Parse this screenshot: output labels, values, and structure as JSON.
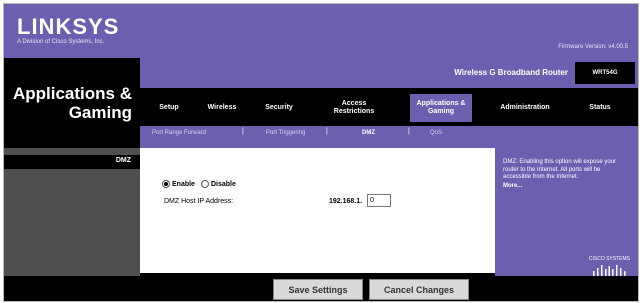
{
  "brand": {
    "logo": "LINKSYS",
    "subtitle": "A Division of Cisco Systems, Inc.",
    "firmware": "Firmware Version: v4.00.5"
  },
  "header": {
    "section_title": "Applications & Gaming",
    "product_name": "Wireless G Broadband Router",
    "model": "WRT54G"
  },
  "tabs": [
    {
      "label": "Setup",
      "active": false
    },
    {
      "label": "Wireless",
      "active": false
    },
    {
      "label": "Security",
      "active": false
    },
    {
      "label": "Access Restrictions",
      "active": false
    },
    {
      "label": "Applications & Gaming",
      "active": true
    },
    {
      "label": "Administration",
      "active": false
    },
    {
      "label": "Status",
      "active": false
    }
  ],
  "subtabs": [
    {
      "label": "Port Range Forward",
      "active": false
    },
    {
      "label": "Port Triggering",
      "active": false
    },
    {
      "label": "DMZ",
      "active": true
    },
    {
      "label": "QoS",
      "active": false
    }
  ],
  "sidebar": {
    "section": "DMZ"
  },
  "dmz": {
    "enable_label": "Enable",
    "disable_label": "Disable",
    "selected": "enable",
    "host_label": "DMZ Host IP Address:",
    "ip_prefix": "192.168.1.",
    "ip_value": "0"
  },
  "buttons": {
    "save": "Save Settings",
    "cancel": "Cancel Changes"
  },
  "help": {
    "text": "DMZ: Enabling this option will expose your router to the Internet. All ports will be accessible from the Internet.",
    "more": "More..."
  },
  "cisco": {
    "label": "CISCO SYSTEMS"
  },
  "colors": {
    "accent": "#6b5fb0",
    "dark": "#000000",
    "sidebar": "#4f4f4f"
  }
}
